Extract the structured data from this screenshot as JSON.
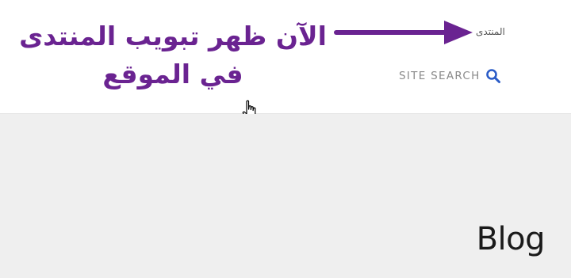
{
  "header": {
    "nav": {
      "forum_label": "المنتدى"
    },
    "site_search": {
      "label": "SITE SEARCH",
      "icon": "search-icon"
    },
    "annotation": {
      "line1": "الآن ظهر تبويب المنتدى",
      "line2": "في الموقع",
      "color": "#6a2391"
    }
  },
  "main": {
    "title": "Blog"
  },
  "cursor": {
    "icon": "hand-pointer-icon"
  }
}
